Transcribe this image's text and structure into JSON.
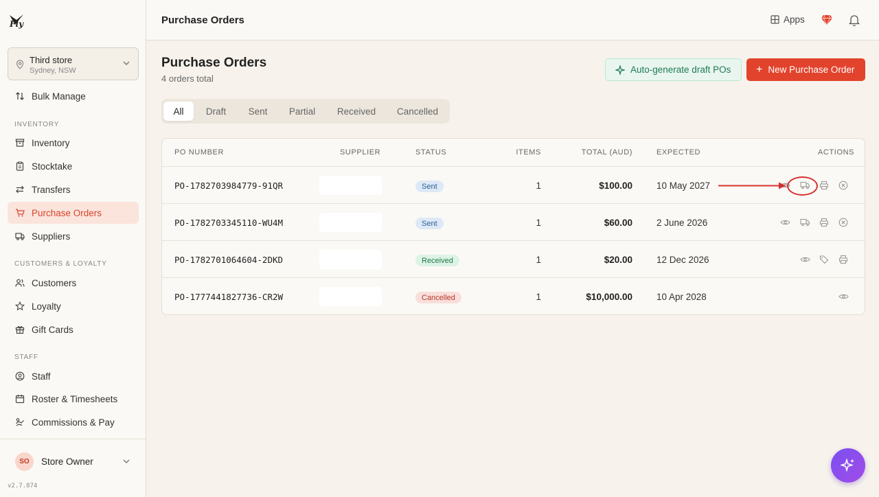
{
  "app": {
    "logo_text": "Fly",
    "version": "v2.7.874"
  },
  "store": {
    "name": "Third store",
    "location": "Sydney, NSW"
  },
  "sidebar": {
    "top_item": {
      "label": "Bulk Manage",
      "icon": "arrows-updown-icon"
    },
    "sections": [
      {
        "title": "INVENTORY",
        "items": [
          {
            "label": "Inventory",
            "icon": "box-icon"
          },
          {
            "label": "Stocktake",
            "icon": "clipboard-icon"
          },
          {
            "label": "Transfers",
            "icon": "transfer-icon"
          },
          {
            "label": "Purchase Orders",
            "icon": "cart-icon",
            "active": true
          },
          {
            "label": "Suppliers",
            "icon": "truck-icon"
          }
        ]
      },
      {
        "title": "CUSTOMERS & LOYALTY",
        "items": [
          {
            "label": "Customers",
            "icon": "users-icon"
          },
          {
            "label": "Loyalty",
            "icon": "star-icon"
          },
          {
            "label": "Gift Cards",
            "icon": "gift-icon"
          }
        ]
      },
      {
        "title": "STAFF",
        "items": [
          {
            "label": "Staff",
            "icon": "user-circle-icon"
          },
          {
            "label": "Roster & Timesheets",
            "icon": "calendar-icon"
          },
          {
            "label": "Commissions & Pay",
            "icon": "money-icon"
          }
        ]
      }
    ]
  },
  "user": {
    "initials": "SO",
    "name": "Store Owner"
  },
  "topbar": {
    "title": "Purchase Orders",
    "apps_label": "Apps"
  },
  "page": {
    "title": "Purchase Orders",
    "subtitle": "4 orders total",
    "auto_button": "Auto-generate draft POs",
    "new_button": "New Purchase Order"
  },
  "tabs": [
    {
      "label": "All",
      "active": true
    },
    {
      "label": "Draft"
    },
    {
      "label": "Sent"
    },
    {
      "label": "Partial"
    },
    {
      "label": "Received"
    },
    {
      "label": "Cancelled"
    }
  ],
  "table": {
    "headers": {
      "po_number": "PO NUMBER",
      "supplier": "SUPPLIER",
      "status": "STATUS",
      "items": "ITEMS",
      "total": "TOTAL (AUD)",
      "expected": "EXPECTED",
      "actions": "ACTIONS"
    },
    "rows": [
      {
        "po": "PO-1782703984779-91QR",
        "status": "Sent",
        "items": "1",
        "total": "$100.00",
        "expected": "10 May 2027",
        "actions": [
          "view-icon",
          "truck-icon",
          "print-icon",
          "cancel-icon"
        ]
      },
      {
        "po": "PO-1782703345110-WU4M",
        "status": "Sent",
        "items": "1",
        "total": "$60.00",
        "expected": "2 June 2026",
        "actions": [
          "view-icon",
          "truck-icon",
          "print-icon",
          "cancel-icon"
        ]
      },
      {
        "po": "PO-1782701064604-2DKD",
        "status": "Received",
        "items": "1",
        "total": "$20.00",
        "expected": "12 Dec 2026",
        "actions": [
          "view-icon",
          "tag-icon",
          "print-icon"
        ]
      },
      {
        "po": "PO-1777441827736-CR2W",
        "status": "Cancelled",
        "items": "1",
        "total": "$10,000.00",
        "expected": "10 Apr 2028",
        "actions": [
          "view-icon"
        ]
      }
    ]
  },
  "colors": {
    "accent": "#e2432c",
    "annotation": "#d62f2f",
    "fab": "#8b4ee8"
  }
}
